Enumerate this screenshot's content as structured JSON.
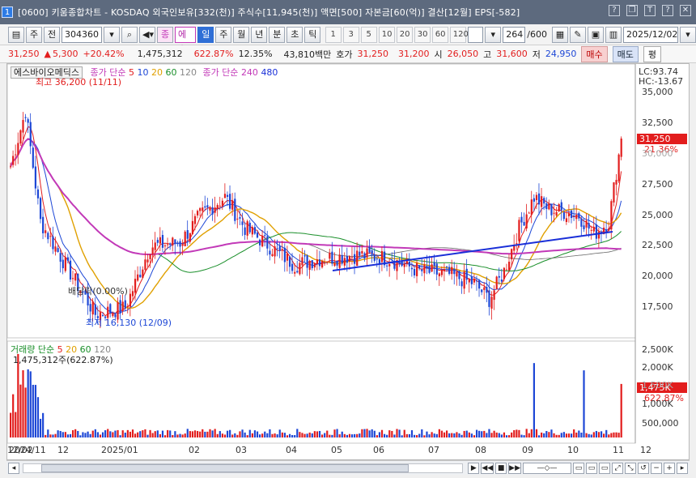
{
  "window": {
    "index": "1",
    "title": "[0600] 키움종합차트 - KOSDAQ 외국인보유[332(천)] 주식수[11,945(천)] 액면[500] 자본금[60(억)] 결산[12월] EPS[-582]"
  },
  "toolbar": {
    "period_type": "주",
    "field": "전",
    "code": "304360",
    "market_flag": "종",
    "stock_name": "에스바이오",
    "chart_types": [
      "일",
      "주",
      "월",
      "년",
      "분",
      "초",
      "틱"
    ],
    "active_type": "일",
    "intervals": [
      "1",
      "3",
      "5",
      "10",
      "20",
      "30",
      "60",
      "120"
    ],
    "count": "264",
    "count_total": "/600",
    "date": "2025/12/02"
  },
  "quote": {
    "price": "31,250",
    "change": "5,300",
    "change_pct": "+20.42%",
    "volume": "1,475,312",
    "volume_pct": "622.87%",
    "turnover_pct": "12.35%",
    "amount": "43,810백만",
    "ask_label": "호가",
    "ask": "31,250",
    "bid": "31,200",
    "open_label": "시",
    "open": "26,050",
    "high_label": "고",
    "high": "31,600",
    "low_label": "저",
    "low": "24,950",
    "buy_label": "매수",
    "sell_label": "매도",
    "eval_label": "평"
  },
  "price_panel": {
    "legend_name": "에스바이오메딕스",
    "ma_label": "종가 단순",
    "ma_periods": [
      "5",
      "10",
      "20",
      "60",
      "120"
    ],
    "ma2_label": "종가 단순",
    "ma2_periods": [
      "240",
      "480"
    ],
    "lc": "LC:93.74",
    "hc": "HC:-13.67",
    "high_note": "최고 36,200 (11/11)",
    "low_note": "최저 16,130 (12/09)",
    "div_note": "배당락(0.00%)",
    "current_tag": "31,250",
    "current_pct": "21.36%",
    "y_ticks": [
      "35,000",
      "32,500",
      "30,000",
      "27,500",
      "25,000",
      "22,500",
      "20,000",
      "17,500"
    ]
  },
  "volume_panel": {
    "legend": "거래량 단순",
    "periods": [
      "5",
      "20",
      "60",
      "120"
    ],
    "value_note": "1,475,312주(622.87%)",
    "current_tag": "1,475K",
    "current_pct": "622.87%",
    "y_ticks": [
      "2,500K",
      "2,000K",
      "1,500K",
      "1,000K",
      "500,000"
    ]
  },
  "x_axis": [
    "2024/11",
    "12",
    "2025/01",
    "02",
    "03",
    "04",
    "05",
    "06",
    "07",
    "08",
    "09",
    "10",
    "11",
    "12",
    "12/02"
  ],
  "colors": {
    "up": "#e21d1d",
    "down": "#1d47d6",
    "ma5": "#e21d1d",
    "ma10": "#1d47d6",
    "ma20": "#e0a000",
    "ma60": "#1a8f2a",
    "ma120": "#666666",
    "ma240": "#c239b8",
    "trend": "#1a2fd8"
  }
}
